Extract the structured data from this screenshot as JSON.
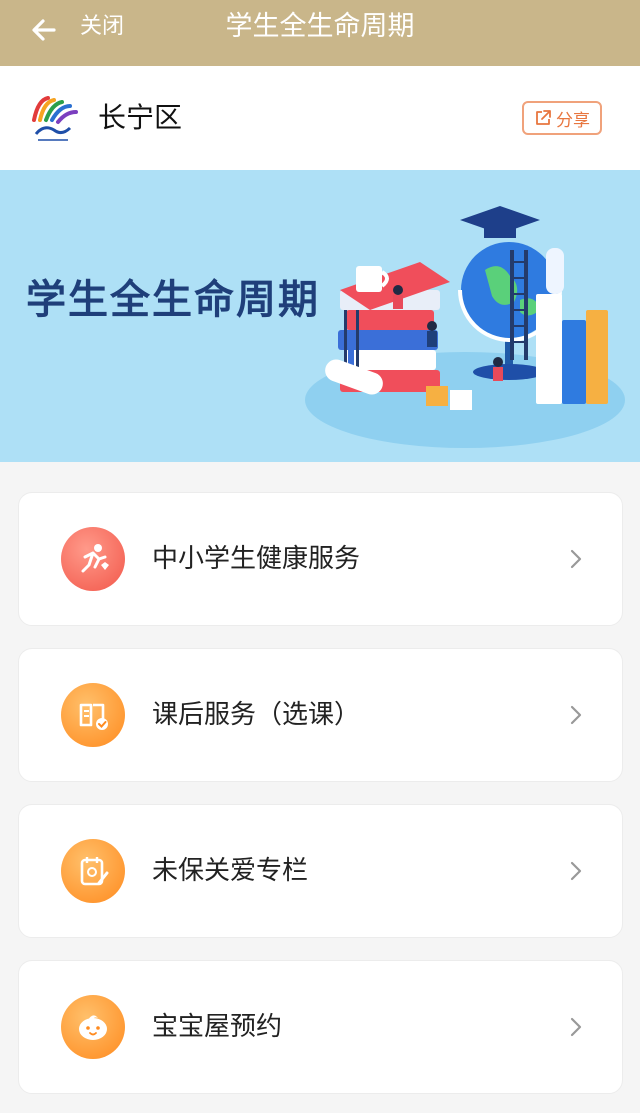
{
  "topbar": {
    "close_label": "关闭",
    "title": "学生全生命周期"
  },
  "header": {
    "district": "长宁区",
    "share_label": "分享"
  },
  "banner": {
    "title": "学生全生命周期"
  },
  "services": [
    {
      "label": "中小学生健康服务",
      "icon": "running-icon",
      "color": "#f2574a"
    },
    {
      "label": "课后服务（选课）",
      "icon": "book-check-icon",
      "color": "#ff8a1e"
    },
    {
      "label": "未保关爱专栏",
      "icon": "notebook-pen-icon",
      "color": "#ff8a1e"
    },
    {
      "label": "宝宝屋预约",
      "icon": "baby-face-icon",
      "color": "#ff8a1e"
    }
  ],
  "colors": {
    "topbar": "#c9b68a",
    "banner": "#aee0f6",
    "share": "#e8763f"
  }
}
